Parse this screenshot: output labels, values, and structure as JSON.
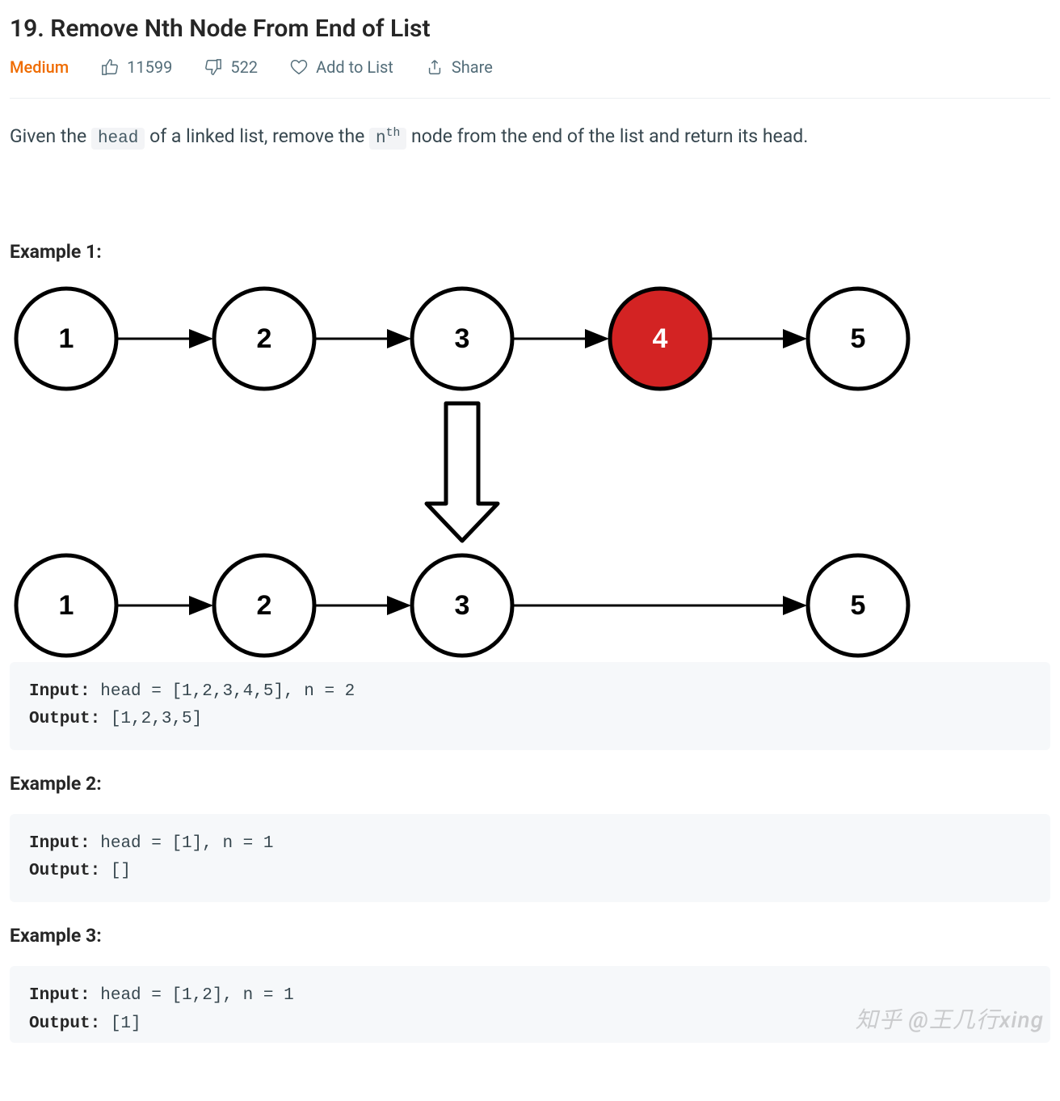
{
  "title": "19. Remove Nth Node From End of List",
  "difficulty": "Medium",
  "likes": "11599",
  "dislikes": "522",
  "add_to_list": "Add to List",
  "share": "Share",
  "description": {
    "pre1": "Given the ",
    "code1": "head",
    "mid1": " of a linked list, remove the ",
    "code2_base": "n",
    "code2_sup": "th",
    "post": " node from the end of the list and return its head."
  },
  "diagram": {
    "top_nodes": [
      {
        "label": "1",
        "fill": "#ffffff",
        "text": "#000"
      },
      {
        "label": "2",
        "fill": "#ffffff",
        "text": "#000"
      },
      {
        "label": "3",
        "fill": "#ffffff",
        "text": "#000"
      },
      {
        "label": "4",
        "fill": "#d32323",
        "text": "#fff"
      },
      {
        "label": "5",
        "fill": "#ffffff",
        "text": "#000"
      }
    ],
    "bottom_nodes": [
      {
        "label": "1",
        "fill": "#ffffff",
        "text": "#000"
      },
      {
        "label": "2",
        "fill": "#ffffff",
        "text": "#000"
      },
      {
        "label": "3",
        "fill": "#ffffff",
        "text": "#000"
      },
      null,
      {
        "label": "5",
        "fill": "#ffffff",
        "text": "#000"
      }
    ]
  },
  "examples": [
    {
      "heading": "Example 1:",
      "input": "head = [1,2,3,4,5], n = 2",
      "output": "[1,2,3,5]"
    },
    {
      "heading": "Example 2:",
      "input": "head = [1], n = 1",
      "output": "[]"
    },
    {
      "heading": "Example 3:",
      "input": "head = [1,2], n = 1",
      "output": "[1]"
    }
  ],
  "labels": {
    "input": "Input:",
    "output": "Output:"
  },
  "watermark": "知乎 @王几行xing"
}
